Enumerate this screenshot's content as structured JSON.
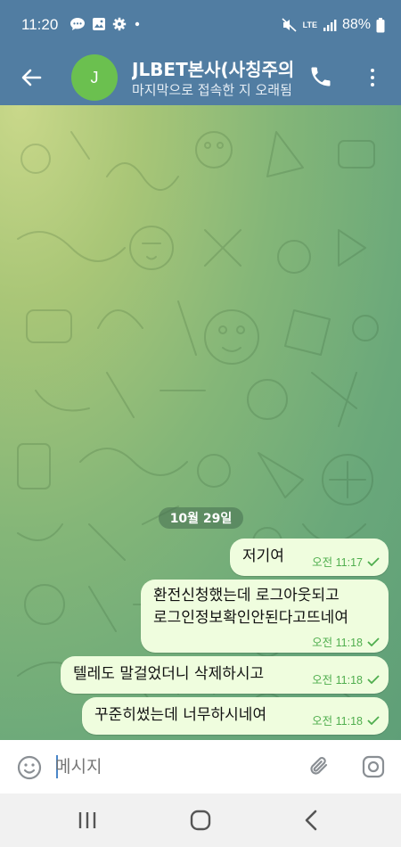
{
  "status_bar": {
    "time": "11:20",
    "network": "LTE",
    "battery": "88%",
    "left_icons": [
      "chat-bubble-icon",
      "gallery-icon",
      "settings-gear-icon",
      "dot-icon"
    ],
    "right_icons": [
      "mute-icon",
      "lte-icon",
      "signal-icon",
      "battery-icon"
    ]
  },
  "header": {
    "avatar_letter": "J",
    "avatar_color": "#6bc04f",
    "title": "JLBET본사(사칭주의",
    "subtitle": "마지막으로 접속한 지 오래됨",
    "bg_color": "#517da2"
  },
  "chat": {
    "date_chip": "10월 29일",
    "messages": [
      {
        "text_lines": [
          "저기여"
        ],
        "time": "오전 11:17",
        "status": "read"
      },
      {
        "text_lines": [
          "환전신청했는데 로그아웃되고",
          "로그인정보확인안된다고뜨네여"
        ],
        "time": "오전 11:18",
        "status": "read"
      },
      {
        "text_lines": [
          "텔레도 말걸었더니 삭제하시고"
        ],
        "time": "오전 11:18",
        "status": "read"
      },
      {
        "text_lines": [
          "꾸준히썼는데 너무하시네여"
        ],
        "time": "오전 11:18",
        "status": "read"
      }
    ],
    "bubble_color": "#effdde",
    "meta_color": "#4fae4e"
  },
  "input_bar": {
    "placeholder": "메시지"
  }
}
